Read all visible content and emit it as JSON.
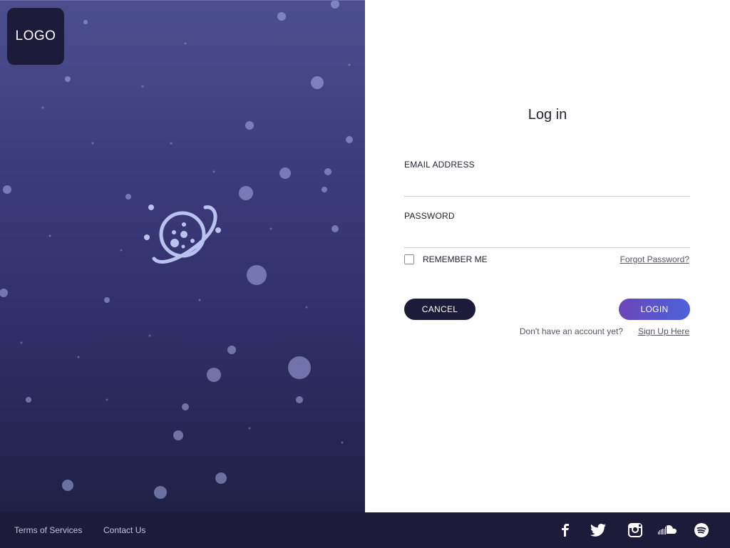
{
  "brand": {
    "logo_text": "LOGO"
  },
  "form": {
    "title": "Log in",
    "email_label": "EMAIL ADDRESS",
    "email_value": "",
    "password_label": "PASSWORD",
    "password_value": "",
    "remember_label": "REMEMBER ME",
    "remember_checked": false,
    "forgot_link": "Forgot Password?",
    "cancel_button": "CANCEL",
    "login_button": "LOGIN",
    "no_account_text": "Don't have an account yet?",
    "signup_link": "Sign Up Here"
  },
  "footer": {
    "links": [
      "Terms of Services",
      "Contact Us"
    ],
    "social_icons": [
      "facebook-icon",
      "twitter-icon",
      "instagram-icon",
      "soundcloud-icon",
      "spotify-icon"
    ]
  },
  "colors": {
    "dark_navy": "#1c1c3a",
    "login_gradient_start": "#6a46b8",
    "login_gradient_end": "#4c63db",
    "hero_top": "#4c4f8f",
    "hero_bottom": "#202046"
  }
}
